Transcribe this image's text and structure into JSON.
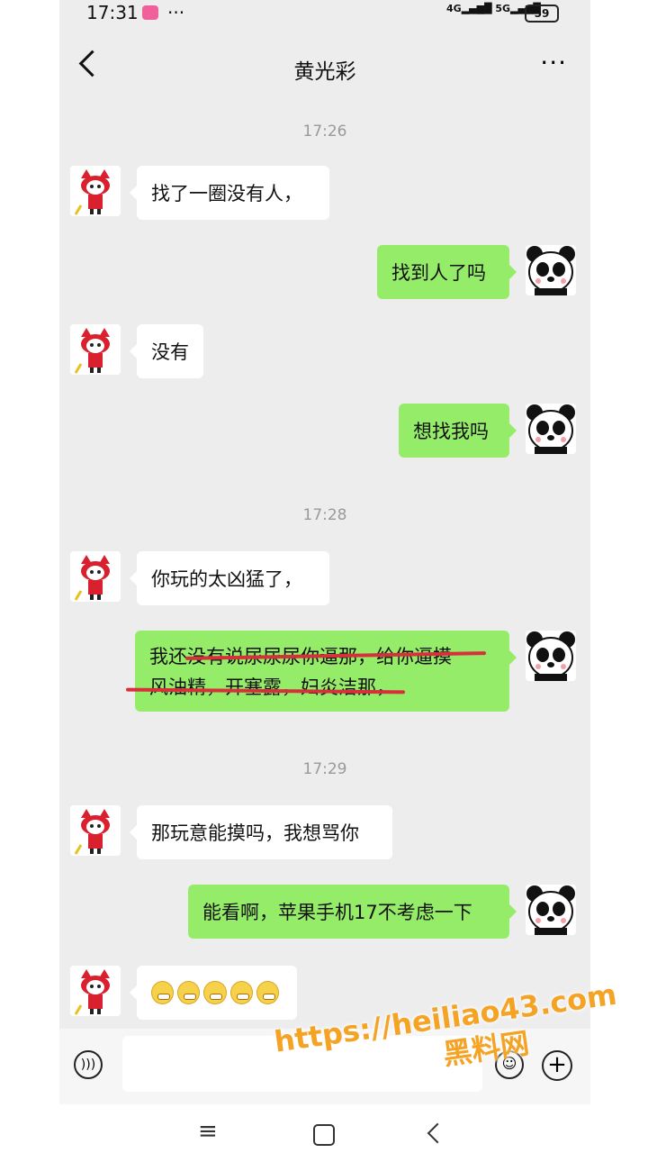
{
  "status_bar": {
    "time": "17:31",
    "dots": "···",
    "network_4g": "4G",
    "network_5g": "5G",
    "battery": "59"
  },
  "header": {
    "title": "黄光彩",
    "more": "···"
  },
  "messages": [
    {
      "type": "time",
      "text": "17:26"
    },
    {
      "type": "left",
      "text": "找了一圈没有人，"
    },
    {
      "type": "right",
      "text": "找到人了吗"
    },
    {
      "type": "left",
      "text": "没有"
    },
    {
      "type": "right",
      "text": "想找我吗"
    },
    {
      "type": "time",
      "text": "17:28"
    },
    {
      "type": "left",
      "text": "你玩的太凶猛了，"
    },
    {
      "type": "right",
      "line1": "我还没有说尿尿尿你逼那，给你逼摸",
      "line2": "风油精，开塞露，妇炎洁那，"
    },
    {
      "type": "time",
      "text": "17:29"
    },
    {
      "type": "left",
      "text": "那玩意能摸吗，我想骂你"
    },
    {
      "type": "right",
      "text": "能看啊，苹果手机17不考虑一下"
    },
    {
      "type": "left",
      "emoji_count": 5
    }
  ],
  "input_bar": {
    "voice_icon": "voice-icon",
    "emoji_icon": "smile-icon",
    "plus_icon": "plus-icon"
  },
  "watermark": {
    "line1": "https://heiliao43.com",
    "line2": "黑料网"
  },
  "colors": {
    "sent_bubble": "#95ec69",
    "received_bubble": "#ffffff",
    "background": "#ededed",
    "strike": "#d6303b",
    "watermark": "#f4a324"
  }
}
